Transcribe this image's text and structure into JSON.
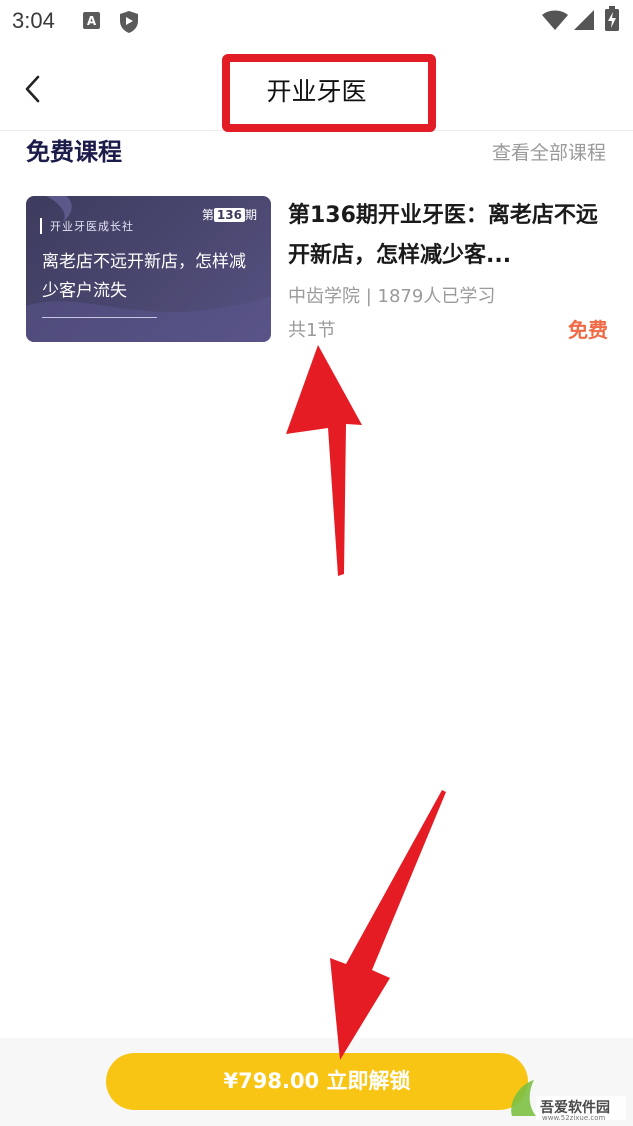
{
  "status_bar": {
    "time": "3:04",
    "icons": [
      "a-notification-icon",
      "shield-icon",
      "wifi-icon",
      "signal-icon",
      "battery-icon"
    ]
  },
  "nav": {
    "title": "开业牙医",
    "back_icon": "chevron-left-icon"
  },
  "section": {
    "title": "免费课程",
    "view_all": "查看全部课程"
  },
  "course": {
    "thumb_brand": "开业牙医成长社",
    "thumb_issue_prefix": "第",
    "thumb_issue_num": "136",
    "thumb_issue_suffix": "期",
    "thumb_text": "离老店不远开新店，怎样减少客户流失",
    "title": "第136期开业牙医：离老店不远开新店，怎样减少客...",
    "meta": "中齿学院 | 1879人已学习",
    "lessons": "共1节",
    "price": "免费"
  },
  "bottom": {
    "unlock_label": "¥798.00  立即解锁"
  },
  "watermark": {
    "text": "吾爱软件园",
    "url": "www.52zixue.com"
  },
  "colors": {
    "accent_yellow": "#f8c514",
    "price_orange": "#f06a45",
    "annotation_red": "#e21d25",
    "section_title": "#1c1c4a"
  }
}
